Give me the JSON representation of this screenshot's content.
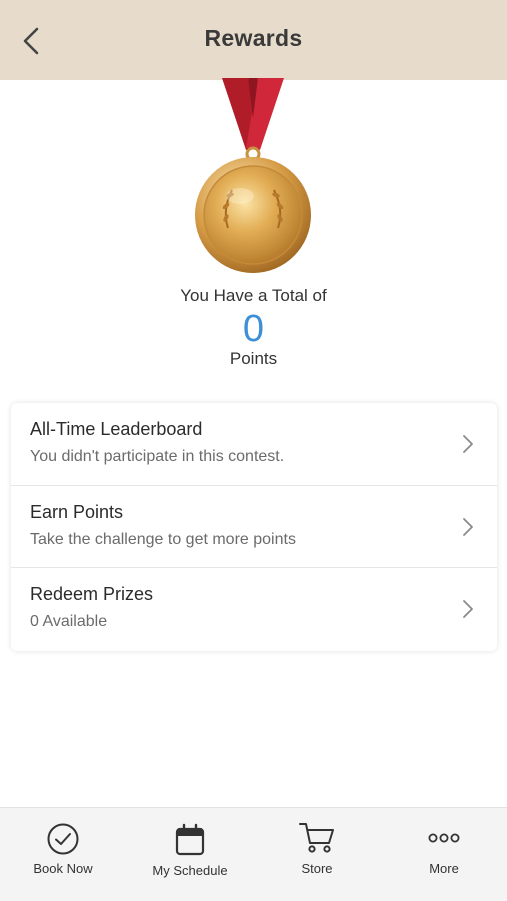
{
  "header": {
    "title": "Rewards",
    "back_icon": "chevron-left-icon"
  },
  "summary": {
    "total_label": "You Have a Total of",
    "points_value": "0",
    "points_unit": "Points",
    "medal_icon": "gold-medal-icon",
    "accent_color": "#3d8fd6"
  },
  "menu": [
    {
      "title": "All-Time Leaderboard",
      "subtitle": "You didn't participate in this contest."
    },
    {
      "title": "Earn Points",
      "subtitle": "Take the challenge to get more points"
    },
    {
      "title": "Redeem Prizes",
      "subtitle": "0 Available"
    }
  ],
  "tabbar": [
    {
      "label": "Book Now",
      "icon": "check-circle-icon"
    },
    {
      "label": "My Schedule",
      "icon": "calendar-icon"
    },
    {
      "label": "Store",
      "icon": "cart-icon"
    },
    {
      "label": "More",
      "icon": "more-dots-icon"
    }
  ],
  "colors": {
    "header_bg": "#e7dccb",
    "ribbon": "#c8202f",
    "medal_gold": "#d9a441"
  }
}
